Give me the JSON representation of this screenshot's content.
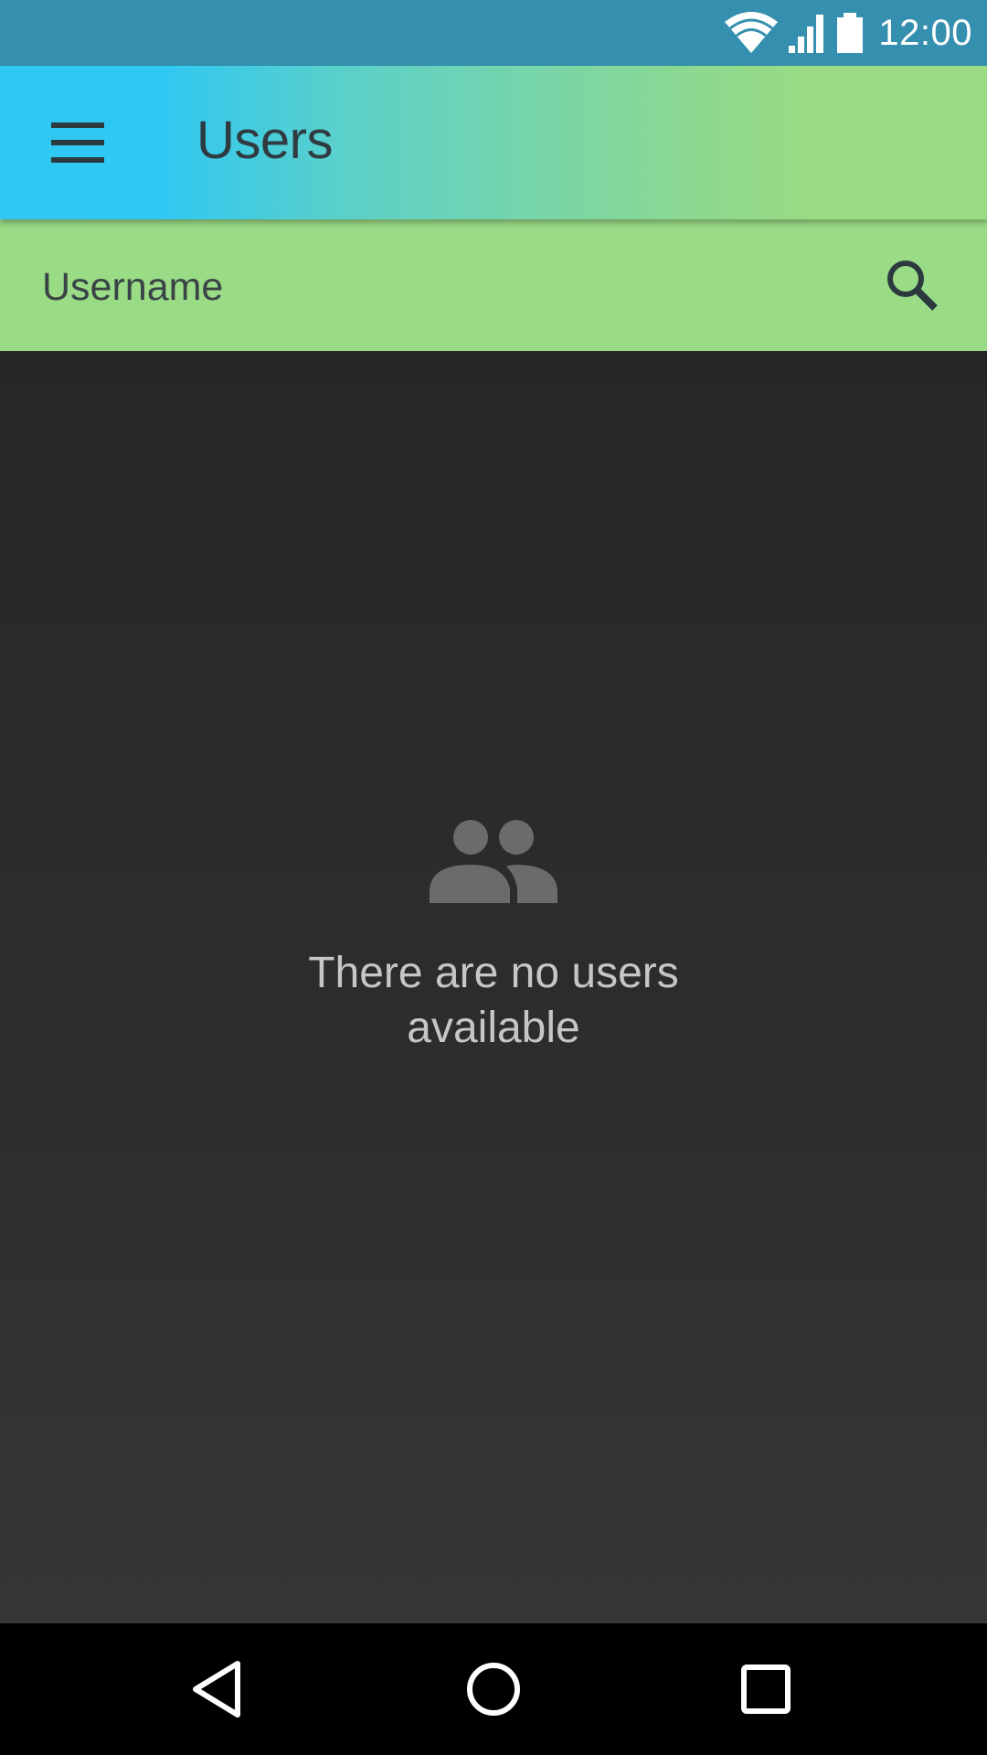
{
  "status_bar": {
    "time": "12:00",
    "icons": [
      "wifi-icon",
      "signal-icon",
      "battery-icon"
    ]
  },
  "app_bar": {
    "title": "Users",
    "menu_icon": "menu-icon",
    "gradient_colors": [
      "#30C8F2",
      "#9ADB84"
    ]
  },
  "search": {
    "placeholder": "Username",
    "value": "",
    "icon": "search-icon",
    "background": "#9ADB86"
  },
  "empty_state": {
    "icon": "people-icon",
    "message": "There are no users available"
  },
  "nav_bar": {
    "buttons": [
      "back-icon",
      "home-icon",
      "recents-icon"
    ]
  },
  "colors": {
    "status_bar": "#3490AE",
    "content_background": "#2a2a2a",
    "empty_icon": "#6b6b6b",
    "empty_text": "#c6c6c6",
    "nav_bar": "#000000"
  }
}
